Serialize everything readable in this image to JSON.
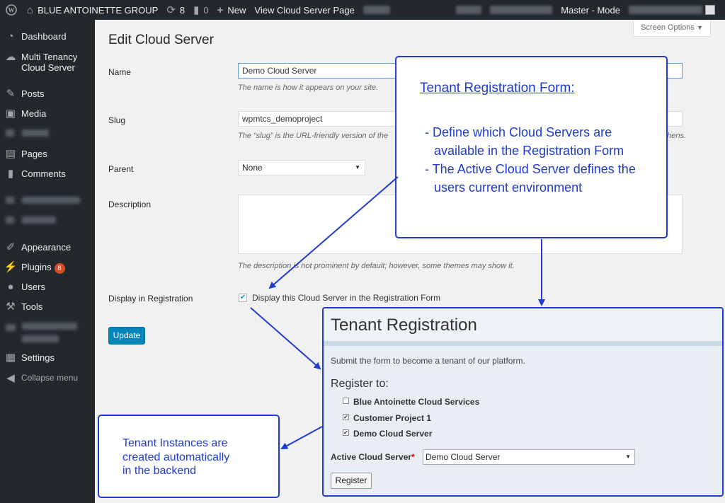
{
  "adminbar": {
    "site_name": "BLUE ANTOINETTE GROUP",
    "updates_count": "8",
    "comments_count": "0",
    "new_label": "New",
    "view_link": "View Cloud Server Page",
    "mode": "Master - Mode"
  },
  "sidebar": {
    "items": [
      {
        "label": "Dashboard"
      },
      {
        "label": "Multi Tenancy Cloud Server"
      },
      {
        "label": "Posts"
      },
      {
        "label": "Media"
      },
      {
        "label": "Pages"
      },
      {
        "label": "Comments"
      },
      {
        "label": "Appearance"
      },
      {
        "label": "Plugins",
        "badge": "8"
      },
      {
        "label": "Users"
      },
      {
        "label": "Tools"
      },
      {
        "label": "Settings"
      },
      {
        "label": "Collapse menu"
      }
    ]
  },
  "screen_options": "Screen Options",
  "page": {
    "title": "Edit Cloud Server",
    "name_label": "Name",
    "name_value": "Demo Cloud Server",
    "name_desc": "The name is how it appears on your site.",
    "slug_label": "Slug",
    "slug_value": "wpmtcs_demoproject",
    "slug_desc": "The “slug” is the URL-friendly version of the",
    "slug_desc_tail": "phens.",
    "parent_label": "Parent",
    "parent_value": "None",
    "description_label": "Description",
    "description_desc": "The description is not prominent by default; however, some themes may show it.",
    "registration_label": "Display in Registration",
    "registration_checkbox_label": "Display this Cloud Server in the Registration Form",
    "update_button": "Update"
  },
  "callout_form": {
    "title": "Tenant Registration Form:",
    "line1": "- Define which Cloud Servers are",
    "line2": "available in the Registration Form",
    "line3": "- The Active Cloud Server defines the",
    "line4": "users current environment"
  },
  "callout_backend": {
    "line1": "Tenant Instances are",
    "line2": "created automatically",
    "line3": "in the backend"
  },
  "tenant_registration": {
    "title": "Tenant Registration",
    "intro": "Submit the form to become a tenant of our platform.",
    "register_to": "Register to:",
    "options": [
      {
        "label": "Blue Antoinette Cloud Services",
        "checked": false
      },
      {
        "label": "Customer Project 1",
        "checked": true
      },
      {
        "label": "Demo Cloud Server",
        "checked": true
      }
    ],
    "active_label": "Active Cloud Server",
    "required_mark": "*",
    "active_value": "Demo Cloud Server",
    "register_button": "Register"
  },
  "colors": {
    "accent": "#1f3bd1",
    "button_primary": "#0085ba",
    "sidebar": "#23282d"
  }
}
